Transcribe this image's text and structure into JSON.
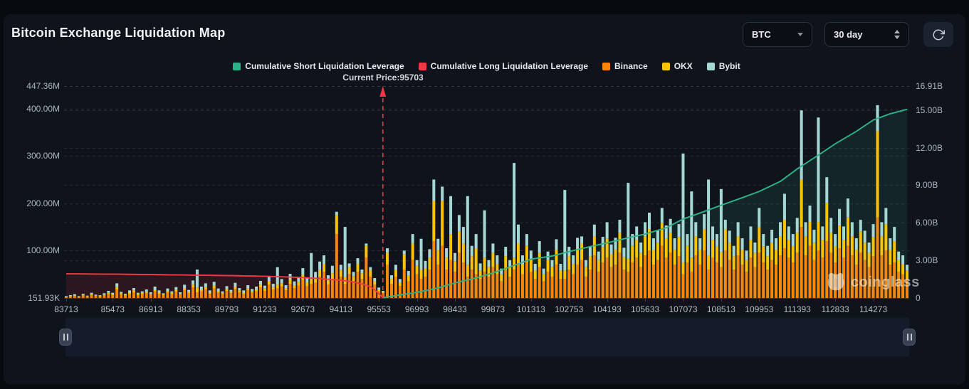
{
  "page": {
    "title": "Bitcoin Exchange Liquidation Map"
  },
  "controls": {
    "coin_select": {
      "value": "BTC"
    },
    "range_select": {
      "value": "30 day"
    }
  },
  "legend": {
    "items": [
      {
        "label": "Cumulative Short Liquidation Leverage",
        "color": "#2eb086"
      },
      {
        "label": "Cumulative Long Liquidation Leverage",
        "color": "#f23645"
      },
      {
        "label": "Binance",
        "color": "#f7860b"
      },
      {
        "label": "OKX",
        "color": "#fcc400"
      },
      {
        "label": "Bybit",
        "color": "#a5d8d4"
      }
    ]
  },
  "annotations": {
    "current_price_label": "Current Price:95703",
    "current_price": 95703
  },
  "watermark": {
    "text": "coinglass"
  },
  "chart_data": {
    "type": "bar",
    "title": "Bitcoin Exchange Liquidation Map",
    "x_axis": {
      "labels": [
        "83713",
        "85473",
        "86913",
        "88353",
        "89793",
        "91233",
        "92673",
        "94113",
        "95553",
        "96993",
        "98433",
        "99873",
        "101313",
        "102753",
        "104193",
        "105633",
        "107073",
        "108513",
        "109953",
        "111393",
        "112833",
        "114273"
      ],
      "price_start": 83713,
      "price_step": 160
    },
    "left_axis": {
      "unit": "USD",
      "ticks": [
        {
          "label": "447.36M",
          "value_m": 447.36
        },
        {
          "label": "400.00M",
          "value_m": 400
        },
        {
          "label": "300.00M",
          "value_m": 300
        },
        {
          "label": "200.00M",
          "value_m": 200
        },
        {
          "label": "100.00M",
          "value_m": 100
        },
        {
          "label": "151.93K",
          "value_m": 0.15193
        }
      ],
      "max_m": 447.36
    },
    "right_axis": {
      "unit": "USD",
      "ticks": [
        {
          "label": "16.91B",
          "value_b": 16.91
        },
        {
          "label": "15.00B",
          "value_b": 15
        },
        {
          "label": "12.00B",
          "value_b": 12
        },
        {
          "label": "9.00B",
          "value_b": 9
        },
        {
          "label": "6.00B",
          "value_b": 6
        },
        {
          "label": "3.00B",
          "value_b": 3
        },
        {
          "label": "0",
          "value_b": 0
        }
      ],
      "max_b": 16.91
    },
    "current_price": 95703,
    "series_bars": {
      "names": [
        "Binance",
        "OKX",
        "Bybit"
      ],
      "colors": [
        "#f7860b",
        "#fcc400",
        "#a5d8d4"
      ],
      "unit": "millions USD",
      "stack_order": "binance,okx,bybit bottom-to-top",
      "values": [
        [
          2,
          1,
          1
        ],
        [
          3,
          1,
          2
        ],
        [
          4,
          2,
          2
        ],
        [
          2,
          1,
          1
        ],
        [
          5,
          2,
          2
        ],
        [
          3,
          1,
          1
        ],
        [
          6,
          2,
          3
        ],
        [
          4,
          1,
          2
        ],
        [
          3,
          2,
          1
        ],
        [
          5,
          2,
          3
        ],
        [
          8,
          3,
          4
        ],
        [
          6,
          2,
          3
        ],
        [
          18,
          5,
          8
        ],
        [
          7,
          3,
          3
        ],
        [
          5,
          2,
          2
        ],
        [
          9,
          3,
          4
        ],
        [
          12,
          4,
          5
        ],
        [
          6,
          2,
          3
        ],
        [
          8,
          3,
          3
        ],
        [
          10,
          3,
          5
        ],
        [
          7,
          2,
          3
        ],
        [
          14,
          4,
          6
        ],
        [
          9,
          3,
          4
        ],
        [
          6,
          2,
          2
        ],
        [
          11,
          4,
          5
        ],
        [
          8,
          3,
          3
        ],
        [
          13,
          4,
          6
        ],
        [
          7,
          2,
          3
        ],
        [
          16,
          5,
          7
        ],
        [
          10,
          3,
          4
        ],
        [
          22,
          6,
          9
        ],
        [
          12,
          10,
          38
        ],
        [
          14,
          4,
          6
        ],
        [
          18,
          5,
          8
        ],
        [
          9,
          3,
          4
        ],
        [
          20,
          6,
          8
        ],
        [
          11,
          4,
          5
        ],
        [
          8,
          3,
          3
        ],
        [
          15,
          4,
          6
        ],
        [
          10,
          3,
          4
        ],
        [
          19,
          5,
          8
        ],
        [
          12,
          4,
          5
        ],
        [
          9,
          3,
          4
        ],
        [
          16,
          5,
          6
        ],
        [
          11,
          3,
          5
        ],
        [
          14,
          4,
          6
        ],
        [
          22,
          6,
          8
        ],
        [
          15,
          5,
          6
        ],
        [
          28,
          8,
          10
        ],
        [
          18,
          5,
          7
        ],
        [
          20,
          8,
          37
        ],
        [
          24,
          7,
          9
        ],
        [
          16,
          5,
          6
        ],
        [
          30,
          9,
          12
        ],
        [
          21,
          6,
          8
        ],
        [
          26,
          8,
          10
        ],
        [
          38,
          11,
          14
        ],
        [
          25,
          8,
          10
        ],
        [
          30,
          10,
          55
        ],
        [
          32,
          10,
          13
        ],
        [
          45,
          14,
          18
        ],
        [
          55,
          17,
          18
        ],
        [
          28,
          9,
          11
        ],
        [
          40,
          12,
          16
        ],
        [
          135,
          40,
          7
        ],
        [
          45,
          14,
          11
        ],
        [
          30,
          15,
          105
        ],
        [
          50,
          15,
          8
        ],
        [
          35,
          11,
          9
        ],
        [
          55,
          17,
          12
        ],
        [
          40,
          12,
          8
        ],
        [
          85,
          25,
          5
        ],
        [
          45,
          13,
          7
        ],
        [
          28,
          8,
          6
        ],
        [
          14,
          4,
          4
        ],
        [
          10,
          3,
          2
        ],
        [
          70,
          25,
          10
        ],
        [
          30,
          10,
          8
        ],
        [
          45,
          15,
          10
        ],
        [
          25,
          8,
          7
        ],
        [
          60,
          32,
          8
        ],
        [
          35,
          12,
          10
        ],
        [
          80,
          35,
          20
        ],
        [
          50,
          18,
          12
        ],
        [
          40,
          20,
          65
        ],
        [
          45,
          18,
          15
        ],
        [
          60,
          25,
          18
        ],
        [
          120,
          85,
          45
        ],
        [
          70,
          30,
          25
        ],
        [
          110,
          95,
          30
        ],
        [
          60,
          25,
          20
        ],
        [
          80,
          55,
          80
        ],
        [
          55,
          22,
          18
        ],
        [
          95,
          45,
          35
        ],
        [
          75,
          40,
          35
        ],
        [
          45,
          25,
          145
        ],
        [
          60,
          28,
          22
        ],
        [
          50,
          55,
          30
        ],
        [
          40,
          18,
          15
        ],
        [
          55,
          30,
          100
        ],
        [
          45,
          20,
          15
        ],
        [
          65,
          30,
          20
        ],
        [
          50,
          22,
          18
        ],
        [
          35,
          15,
          12
        ],
        [
          60,
          28,
          20
        ],
        [
          45,
          20,
          15
        ],
        [
          60,
          25,
          200
        ],
        [
          70,
          45,
          40
        ],
        [
          50,
          22,
          18
        ],
        [
          75,
          35,
          25
        ],
        [
          55,
          25,
          20
        ],
        [
          40,
          18,
          14
        ],
        [
          65,
          30,
          25
        ],
        [
          35,
          15,
          12
        ],
        [
          55,
          25,
          18
        ],
        [
          45,
          20,
          15
        ],
        [
          70,
          32,
          22
        ],
        [
          40,
          18,
          14
        ],
        [
          40,
          18,
          170
        ],
        [
          60,
          28,
          20
        ],
        [
          50,
          22,
          18
        ],
        [
          70,
          32,
          25
        ],
        [
          80,
          35,
          15
        ],
        [
          45,
          20,
          15
        ],
        [
          60,
          28,
          20
        ],
        [
          90,
          40,
          25
        ],
        [
          55,
          25,
          18
        ],
        [
          75,
          32,
          22
        ],
        [
          85,
          40,
          35
        ],
        [
          65,
          28,
          20
        ],
        [
          70,
          32,
          25
        ],
        [
          95,
          42,
          28
        ],
        [
          60,
          26,
          20
        ],
        [
          55,
          28,
          160
        ],
        [
          75,
          35,
          25
        ],
        [
          85,
          38,
          28
        ],
        [
          65,
          30,
          22
        ],
        [
          90,
          40,
          30
        ],
        [
          100,
          45,
          35
        ],
        [
          70,
          32,
          24
        ],
        [
          80,
          36,
          26
        ],
        [
          110,
          48,
          32
        ],
        [
          85,
          40,
          28
        ],
        [
          95,
          42,
          30
        ],
        [
          70,
          32,
          24
        ],
        [
          88,
          40,
          28
        ],
        [
          50,
          25,
          230
        ],
        [
          75,
          35,
          25
        ],
        [
          55,
          30,
          140
        ],
        [
          90,
          40,
          30
        ],
        [
          70,
          32,
          24
        ],
        [
          100,
          45,
          32
        ],
        [
          60,
          30,
          160
        ],
        [
          85,
          38,
          28
        ],
        [
          75,
          34,
          26
        ],
        [
          65,
          32,
          133
        ],
        [
          100,
          45,
          20
        ],
        [
          80,
          36,
          26
        ],
        [
          60,
          28,
          22
        ],
        [
          90,
          40,
          30
        ],
        [
          70,
          32,
          24
        ],
        [
          55,
          25,
          20
        ],
        [
          85,
          38,
          28
        ],
        [
          65,
          30,
          22
        ],
        [
          95,
          55,
          40
        ],
        [
          75,
          34,
          26
        ],
        [
          60,
          28,
          22
        ],
        [
          80,
          36,
          28
        ],
        [
          70,
          32,
          24
        ],
        [
          90,
          40,
          30
        ],
        [
          105,
          60,
          55
        ],
        [
          85,
          38,
          28
        ],
        [
          75,
          34,
          26
        ],
        [
          95,
          42,
          32
        ],
        [
          150,
          100,
          146
        ],
        [
          90,
          40,
          30
        ],
        [
          110,
          50,
          35
        ],
        [
          80,
          36,
          28
        ],
        [
          100,
          60,
          221
        ],
        [
          85,
          38,
          28
        ],
        [
          120,
          80,
          55
        ],
        [
          95,
          42,
          32
        ],
        [
          75,
          34,
          26
        ],
        [
          105,
          48,
          35
        ],
        [
          85,
          38,
          28
        ],
        [
          110,
          60,
          40
        ],
        [
          90,
          40,
          30
        ],
        [
          70,
          32,
          24
        ],
        [
          95,
          45,
          25
        ],
        [
          80,
          36,
          26
        ],
        [
          65,
          30,
          22
        ],
        [
          88,
          40,
          28
        ],
        [
          170,
          182,
          55
        ],
        [
          90,
          40,
          30
        ],
        [
          100,
          55,
          35
        ],
        [
          70,
          32,
          24
        ],
        [
          75,
          45,
          30
        ],
        [
          55,
          25,
          18
        ],
        [
          50,
          22,
          18
        ],
        [
          40,
          18,
          12
        ]
      ]
    },
    "series_lines": [
      {
        "name": "Cumulative Short Liquidation Leverage",
        "color": "#2eb086",
        "unit": "billions USD",
        "points": [
          [
            95703,
            0.02
          ],
          [
            96513,
            0.3
          ],
          [
            96993,
            0.45
          ],
          [
            97793,
            0.8
          ],
          [
            98433,
            1.2
          ],
          [
            99233,
            1.6
          ],
          [
            99873,
            2.0
          ],
          [
            100673,
            2.6
          ],
          [
            101313,
            3.1
          ],
          [
            102113,
            3.35
          ],
          [
            102753,
            3.7
          ],
          [
            103553,
            4.1
          ],
          [
            104193,
            4.4
          ],
          [
            104993,
            4.8
          ],
          [
            105633,
            5.1
          ],
          [
            106433,
            5.6
          ],
          [
            107073,
            6.3
          ],
          [
            107873,
            6.9
          ],
          [
            108513,
            7.4
          ],
          [
            109313,
            8.0
          ],
          [
            109953,
            8.5
          ],
          [
            110753,
            9.3
          ],
          [
            111393,
            10.3
          ],
          [
            112193,
            11.4
          ],
          [
            112833,
            12.3
          ],
          [
            113633,
            13.3
          ],
          [
            114273,
            14.2
          ],
          [
            114913,
            14.7
          ],
          [
            115553,
            15.05
          ]
        ]
      },
      {
        "name": "Cumulative Long Liquidation Leverage",
        "color": "#f23645",
        "unit": "billions USD",
        "points": [
          [
            83713,
            1.93
          ],
          [
            85473,
            1.9
          ],
          [
            86913,
            1.87
          ],
          [
            88353,
            1.83
          ],
          [
            89793,
            1.79
          ],
          [
            91233,
            1.73
          ],
          [
            92033,
            1.68
          ],
          [
            92673,
            1.63
          ],
          [
            93313,
            1.55
          ],
          [
            94113,
            1.42
          ],
          [
            94593,
            1.28
          ],
          [
            94913,
            1.12
          ],
          [
            95233,
            0.9
          ],
          [
            95393,
            0.65
          ],
          [
            95553,
            0.35
          ],
          [
            95703,
            0.03
          ]
        ]
      }
    ]
  }
}
